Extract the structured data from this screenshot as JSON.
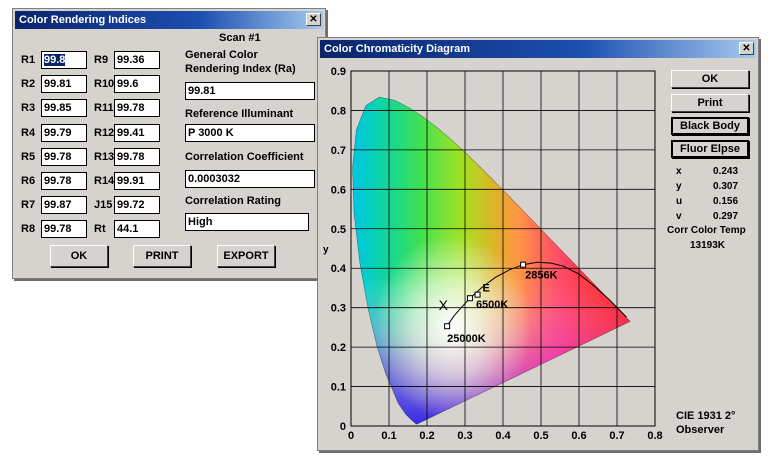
{
  "cri_window": {
    "title": "Color Rendering Indices",
    "scan_label": "Scan #1",
    "left_rows": [
      {
        "label": "R1",
        "value": "99.8"
      },
      {
        "label": "R2",
        "value": "99.81"
      },
      {
        "label": "R3",
        "value": "99.85"
      },
      {
        "label": "R4",
        "value": "99.79"
      },
      {
        "label": "R5",
        "value": "99.78"
      },
      {
        "label": "R6",
        "value": "99.78"
      },
      {
        "label": "R7",
        "value": "99.87"
      },
      {
        "label": "R8",
        "value": "99.78"
      }
    ],
    "right_rows": [
      {
        "label": "R9",
        "value": "99.36"
      },
      {
        "label": "R10",
        "value": "99.6"
      },
      {
        "label": "R11",
        "value": "99.78"
      },
      {
        "label": "R12",
        "value": "99.41"
      },
      {
        "label": "R13",
        "value": "99.78"
      },
      {
        "label": "R14",
        "value": "99.91"
      },
      {
        "label": "J15",
        "value": "99.72"
      },
      {
        "label": "Rt",
        "value": "44.1"
      }
    ],
    "general_cri_label_1": "General Color",
    "general_cri_label_2": "Rendering Index (Ra)",
    "general_cri_value": "99.81",
    "ref_illuminant_label": "Reference Illuminant",
    "ref_illuminant_value": "P 3000 K",
    "corr_coef_label": "Correlation Coefficient",
    "corr_coef_value": "0.0003032",
    "corr_rating_label": "Correlation Rating",
    "corr_rating_value": "High",
    "buttons": {
      "ok": "OK",
      "print": "PRINT",
      "export": "EXPORT"
    }
  },
  "chroma_window": {
    "title": "Color Chromaticity Diagram",
    "buttons": {
      "ok": "OK",
      "print": "Print",
      "black_body": "Black Body",
      "fluor_elpse": "Fluor Elpse"
    },
    "readouts": [
      {
        "label": "x",
        "value": "0.243"
      },
      {
        "label": "y",
        "value": "0.307"
      },
      {
        "label": "u",
        "value": "0.156"
      },
      {
        "label": "v",
        "value": "0.297"
      }
    ],
    "cct_label": "Corr Color Temp",
    "cct_value": "13193K",
    "observer_label_1": "CIE 1931 2°",
    "observer_label_2": "Observer"
  },
  "chart_data": {
    "type": "scatter",
    "xlabel": "x",
    "ylabel": "y",
    "xlim": [
      0,
      0.8
    ],
    "ylim": [
      0,
      0.9
    ],
    "x_ticks": [
      "0",
      "0.1",
      "0.2",
      "0.3",
      "0.4",
      "0.5",
      "0.6",
      "0.7",
      "0.8"
    ],
    "y_ticks": [
      "0",
      "0.1",
      "0.2",
      "0.3",
      "0.4",
      "0.5",
      "0.6",
      "0.7",
      "0.8",
      "0.9"
    ],
    "grid": true,
    "planckian_points": [
      {
        "x": 0.253,
        "y": 0.253,
        "label": "25000K"
      },
      {
        "x": 0.313,
        "y": 0.324,
        "label": "6500K"
      },
      {
        "x": 0.453,
        "y": 0.409,
        "label": "2856K"
      }
    ],
    "point_e": {
      "x": 0.333,
      "y": 0.333,
      "label": "E"
    },
    "measured_point": {
      "x": 0.243,
      "y": 0.307,
      "label": "X"
    }
  }
}
